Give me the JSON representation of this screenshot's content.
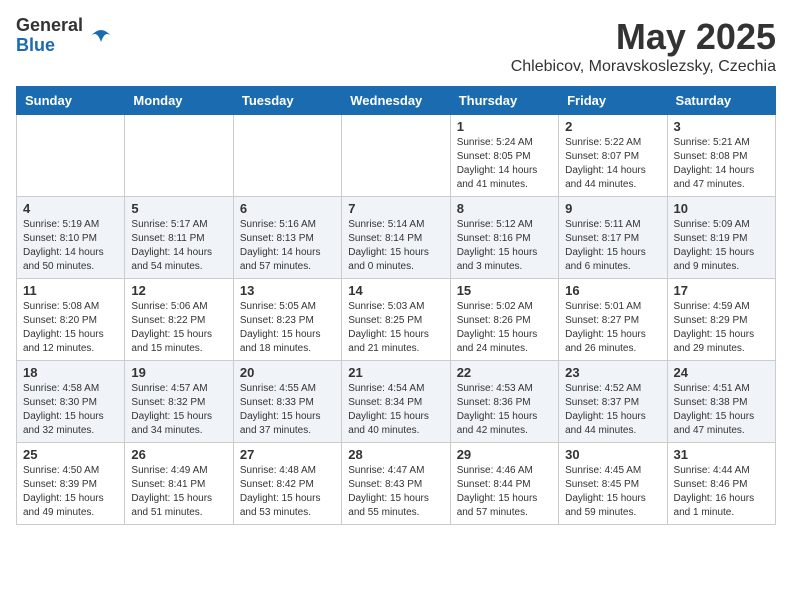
{
  "logo": {
    "general": "General",
    "blue": "Blue"
  },
  "title": "May 2025",
  "subtitle": "Chlebicov, Moravskoslezsky, Czechia",
  "headers": [
    "Sunday",
    "Monday",
    "Tuesday",
    "Wednesday",
    "Thursday",
    "Friday",
    "Saturday"
  ],
  "weeks": [
    [
      {
        "day": "",
        "info": ""
      },
      {
        "day": "",
        "info": ""
      },
      {
        "day": "",
        "info": ""
      },
      {
        "day": "",
        "info": ""
      },
      {
        "day": "1",
        "info": "Sunrise: 5:24 AM\nSunset: 8:05 PM\nDaylight: 14 hours\nand 41 minutes."
      },
      {
        "day": "2",
        "info": "Sunrise: 5:22 AM\nSunset: 8:07 PM\nDaylight: 14 hours\nand 44 minutes."
      },
      {
        "day": "3",
        "info": "Sunrise: 5:21 AM\nSunset: 8:08 PM\nDaylight: 14 hours\nand 47 minutes."
      }
    ],
    [
      {
        "day": "4",
        "info": "Sunrise: 5:19 AM\nSunset: 8:10 PM\nDaylight: 14 hours\nand 50 minutes."
      },
      {
        "day": "5",
        "info": "Sunrise: 5:17 AM\nSunset: 8:11 PM\nDaylight: 14 hours\nand 54 minutes."
      },
      {
        "day": "6",
        "info": "Sunrise: 5:16 AM\nSunset: 8:13 PM\nDaylight: 14 hours\nand 57 minutes."
      },
      {
        "day": "7",
        "info": "Sunrise: 5:14 AM\nSunset: 8:14 PM\nDaylight: 15 hours\nand 0 minutes."
      },
      {
        "day": "8",
        "info": "Sunrise: 5:12 AM\nSunset: 8:16 PM\nDaylight: 15 hours\nand 3 minutes."
      },
      {
        "day": "9",
        "info": "Sunrise: 5:11 AM\nSunset: 8:17 PM\nDaylight: 15 hours\nand 6 minutes."
      },
      {
        "day": "10",
        "info": "Sunrise: 5:09 AM\nSunset: 8:19 PM\nDaylight: 15 hours\nand 9 minutes."
      }
    ],
    [
      {
        "day": "11",
        "info": "Sunrise: 5:08 AM\nSunset: 8:20 PM\nDaylight: 15 hours\nand 12 minutes."
      },
      {
        "day": "12",
        "info": "Sunrise: 5:06 AM\nSunset: 8:22 PM\nDaylight: 15 hours\nand 15 minutes."
      },
      {
        "day": "13",
        "info": "Sunrise: 5:05 AM\nSunset: 8:23 PM\nDaylight: 15 hours\nand 18 minutes."
      },
      {
        "day": "14",
        "info": "Sunrise: 5:03 AM\nSunset: 8:25 PM\nDaylight: 15 hours\nand 21 minutes."
      },
      {
        "day": "15",
        "info": "Sunrise: 5:02 AM\nSunset: 8:26 PM\nDaylight: 15 hours\nand 24 minutes."
      },
      {
        "day": "16",
        "info": "Sunrise: 5:01 AM\nSunset: 8:27 PM\nDaylight: 15 hours\nand 26 minutes."
      },
      {
        "day": "17",
        "info": "Sunrise: 4:59 AM\nSunset: 8:29 PM\nDaylight: 15 hours\nand 29 minutes."
      }
    ],
    [
      {
        "day": "18",
        "info": "Sunrise: 4:58 AM\nSunset: 8:30 PM\nDaylight: 15 hours\nand 32 minutes."
      },
      {
        "day": "19",
        "info": "Sunrise: 4:57 AM\nSunset: 8:32 PM\nDaylight: 15 hours\nand 34 minutes."
      },
      {
        "day": "20",
        "info": "Sunrise: 4:55 AM\nSunset: 8:33 PM\nDaylight: 15 hours\nand 37 minutes."
      },
      {
        "day": "21",
        "info": "Sunrise: 4:54 AM\nSunset: 8:34 PM\nDaylight: 15 hours\nand 40 minutes."
      },
      {
        "day": "22",
        "info": "Sunrise: 4:53 AM\nSunset: 8:36 PM\nDaylight: 15 hours\nand 42 minutes."
      },
      {
        "day": "23",
        "info": "Sunrise: 4:52 AM\nSunset: 8:37 PM\nDaylight: 15 hours\nand 44 minutes."
      },
      {
        "day": "24",
        "info": "Sunrise: 4:51 AM\nSunset: 8:38 PM\nDaylight: 15 hours\nand 47 minutes."
      }
    ],
    [
      {
        "day": "25",
        "info": "Sunrise: 4:50 AM\nSunset: 8:39 PM\nDaylight: 15 hours\nand 49 minutes."
      },
      {
        "day": "26",
        "info": "Sunrise: 4:49 AM\nSunset: 8:41 PM\nDaylight: 15 hours\nand 51 minutes."
      },
      {
        "day": "27",
        "info": "Sunrise: 4:48 AM\nSunset: 8:42 PM\nDaylight: 15 hours\nand 53 minutes."
      },
      {
        "day": "28",
        "info": "Sunrise: 4:47 AM\nSunset: 8:43 PM\nDaylight: 15 hours\nand 55 minutes."
      },
      {
        "day": "29",
        "info": "Sunrise: 4:46 AM\nSunset: 8:44 PM\nDaylight: 15 hours\nand 57 minutes."
      },
      {
        "day": "30",
        "info": "Sunrise: 4:45 AM\nSunset: 8:45 PM\nDaylight: 15 hours\nand 59 minutes."
      },
      {
        "day": "31",
        "info": "Sunrise: 4:44 AM\nSunset: 8:46 PM\nDaylight: 16 hours\nand 1 minute."
      }
    ]
  ]
}
